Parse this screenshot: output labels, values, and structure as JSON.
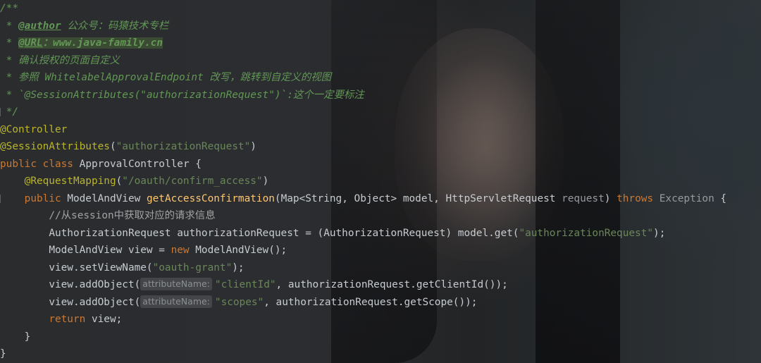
{
  "editor": {
    "colors": {
      "javadoc": "#629755",
      "annotation": "#bbb529",
      "string": "#6a8759",
      "keyword": "#cc7832",
      "method": "#ffc66d",
      "text": "#c7ccd1"
    },
    "doc_comment": {
      "open": "/**",
      "author_tag": "@author",
      "author_text": " 公众号：码猿技术专栏",
      "url_tag": "@URL",
      "url_text": "：www.java-family.cn",
      "line3": "确认授权的页面自定义",
      "line4": "参照 WhitelabelApprovalEndpoint 改写，跳转到自定义的视图",
      "line5": "`@SessionAttributes(\"authorizationRequest\")`:这个一定要标注",
      "close": "*/",
      "star": " * "
    },
    "class_annotations": {
      "controller": "@Controller",
      "session_attr": "@SessionAttributes",
      "session_attr_paren_open": "(",
      "session_attr_value": "\"authorizationRequest\"",
      "session_attr_paren_close": ")"
    },
    "class_decl": {
      "kw_public": "public",
      "kw_class": "class",
      "name": "ApprovalController {"
    },
    "mapping": {
      "annotation": "@RequestMapping",
      "paren_open": "(",
      "value": "\"/oauth/confirm_access\"",
      "paren_close": ")"
    },
    "method_decl": {
      "kw_public": "public",
      "return_type": "ModelAndView",
      "name": "getAccessConfirmation",
      "params_before": "(Map<String, Object> model, HttpServletRequest ",
      "request_param": "request",
      "params_after": ")",
      "kw_throws": "throws",
      "exception": "Exception",
      "brace": " {"
    },
    "body": {
      "comment": "//从session中获取对应的请求信息",
      "line1_type": "AuthorizationRequest authorizationRequest = (AuthorizationRequest) model.get(",
      "line1_string": "\"authorizationRequest\"",
      "line1_end": ");",
      "line2_start": "ModelAndView view = ",
      "line2_kw": "new",
      "line2_end": " ModelAndView();",
      "line3_start": "view.setViewName(",
      "line3_string": "\"oauth-grant\"",
      "line3_end": ");",
      "line4_start": "view.addObject(",
      "line4_hint": "attributeName:",
      "line4_string": "\"clientId\"",
      "line4_end": ", authorizationRequest.getClientId());",
      "line5_start": "view.addObject(",
      "line5_hint": "attributeName:",
      "line5_string": "\"scopes\"",
      "line5_end": ", authorizationRequest.getScope());",
      "return_kw": "return",
      "return_rest": " view;"
    },
    "method_close": "}",
    "class_close": "}"
  }
}
